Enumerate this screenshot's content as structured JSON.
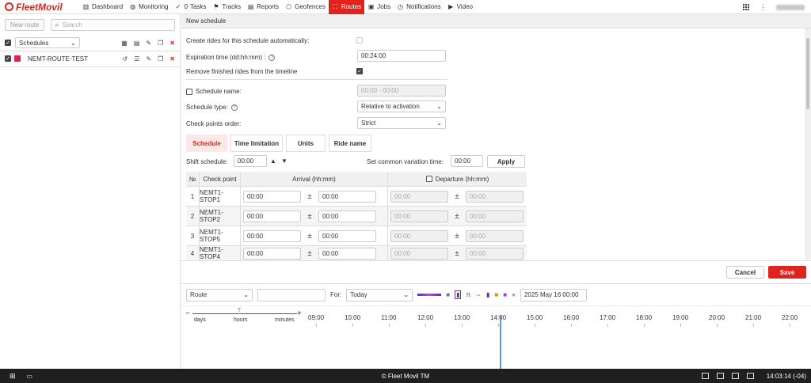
{
  "brand": {
    "name": "FleetMovil",
    "color": "#e0231c"
  },
  "nav": [
    {
      "label": "Dashboard",
      "icon": "bar-chart-icon"
    },
    {
      "label": "Monitoring",
      "icon": "globe-icon"
    },
    {
      "label": "Tasks",
      "icon": "check-circle-icon",
      "badge": "0"
    },
    {
      "label": "Tracks",
      "icon": "flag-icon"
    },
    {
      "label": "Reports",
      "icon": "report-icon"
    },
    {
      "label": "Geofences",
      "icon": "geofence-icon"
    },
    {
      "label": "Routes",
      "icon": "route-icon",
      "active": true
    },
    {
      "label": "Jobs",
      "icon": "clipboard-icon"
    },
    {
      "label": "Notifications",
      "icon": "clock-icon"
    },
    {
      "label": "Video",
      "icon": "video-icon"
    }
  ],
  "sidebar": {
    "new_route": "New route",
    "search_placeholder": "Search",
    "filter_value": "Schedules",
    "routes": [
      {
        "name": "NEMT-ROUTE-TEST",
        "color": "#e0234e"
      }
    ]
  },
  "panel": {
    "title": "New schedule",
    "create_rides_label": "Create rides for this schedule automatically:",
    "expiration_label": "Expiration time (dd:hh:mm)  :",
    "expiration_value": "00:24:00",
    "remove_finished_label": "Remove finished rides from the timeline",
    "schedule_name_label": "Schedule name:",
    "schedule_name_placeholder": "00:00 - 00:00",
    "schedule_type_label": "Schedule type:",
    "schedule_type_value": "Relative to activation",
    "checkpoints_order_label": "Check points order:",
    "checkpoints_order_value": "Strict",
    "tabs": [
      "Schedule",
      "Time limitation",
      "Units",
      "Ride name"
    ],
    "shift_label": "Shift schedule:",
    "shift_value": "00:00",
    "common_variation_label": "Set common variation time:",
    "common_variation_value": "00:00",
    "apply_label": "Apply",
    "table": {
      "headers": {
        "num": "№",
        "checkpoint": "Check point",
        "arrival": "Arrival (hh:mm)",
        "departure": "Departure (hh:mm)"
      },
      "rows": [
        {
          "num": "1",
          "checkpoint": "NEMT1-STOP1",
          "arr1": "00:00",
          "arr2": "00:00",
          "dep1": "00:00",
          "dep2": "00:00"
        },
        {
          "num": "2",
          "checkpoint": "NEMT1-STOP2",
          "arr1": "00:00",
          "arr2": "00:00",
          "dep1": "00:00",
          "dep2": "00:00"
        },
        {
          "num": "3",
          "checkpoint": "NEMT1-STOP5",
          "arr1": "00:00",
          "arr2": "00:00",
          "dep1": "00:00",
          "dep2": "00:00"
        },
        {
          "num": "4",
          "checkpoint": "NEMT1-STOP4",
          "arr1": "00:00",
          "arr2": "00:00",
          "dep1": "00:00",
          "dep2": "00:00"
        }
      ]
    },
    "cancel_label": "Cancel",
    "save_label": "Save"
  },
  "timeline": {
    "group_value": "Route",
    "for_label": "For:",
    "period_value": "Today",
    "date_value": "2025 May 16 00:00",
    "scale_labels": [
      "days",
      "hours",
      "minutes"
    ],
    "hours": [
      "09:00",
      "10:00",
      "11:00",
      "12:00",
      "13:00",
      "14:00",
      "15:00",
      "16:00",
      "17:00",
      "18:00",
      "19:00",
      "20:00",
      "21:00",
      "22:00"
    ]
  },
  "taskbar": {
    "center": "© Fleet Movil TM",
    "time": "14:03:14 (-04)"
  }
}
